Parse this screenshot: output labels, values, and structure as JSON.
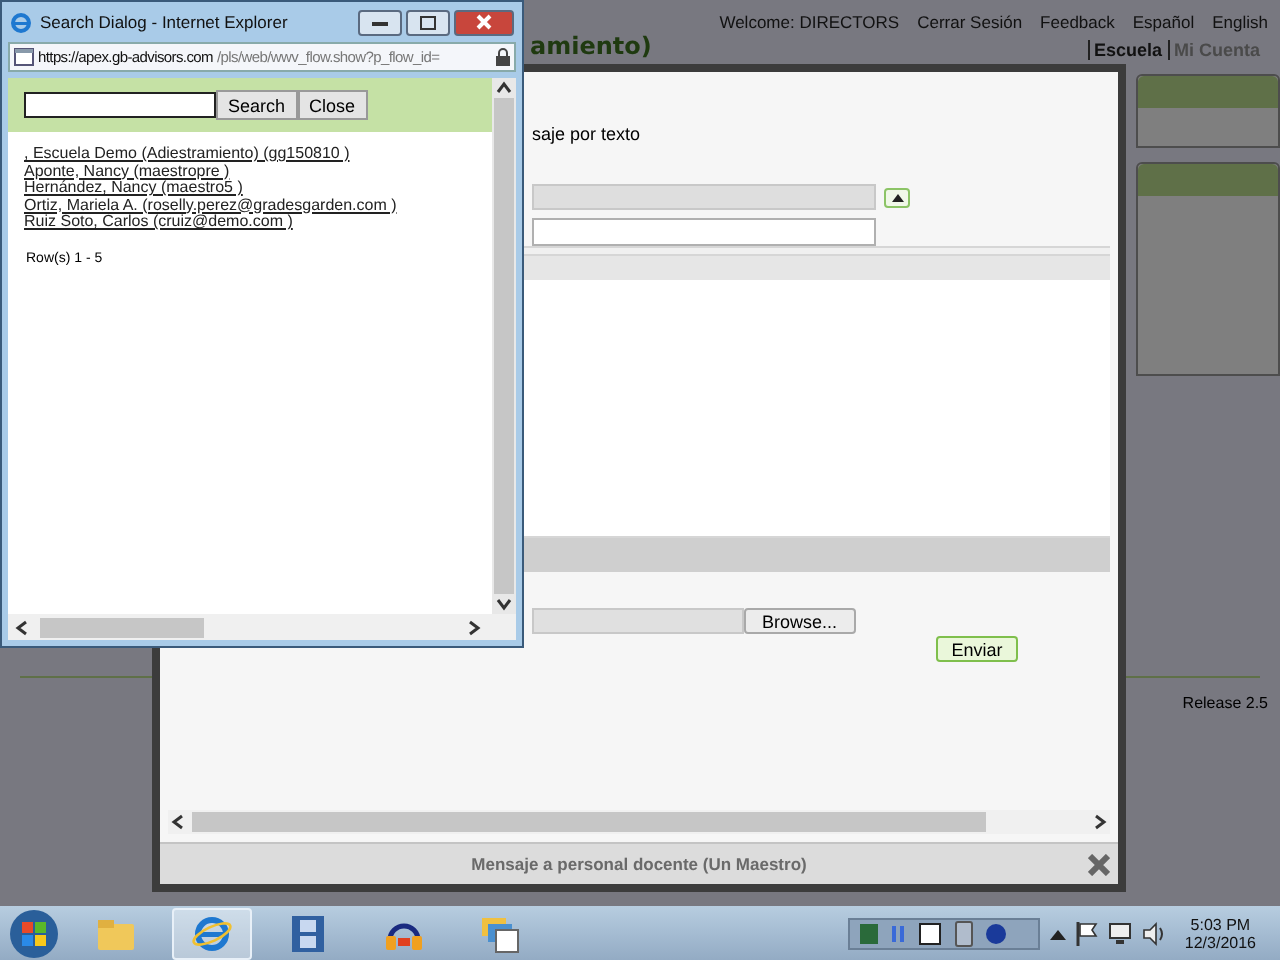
{
  "page": {
    "welcome": "Welcome: DIRECTORS",
    "header_links": [
      "Cerrar Sesión",
      "Feedback",
      "Español",
      "English"
    ],
    "title_fragment": "amiento)",
    "nav": [
      {
        "label": "Escuela",
        "selected": true
      },
      {
        "label": "Mi Cuenta",
        "selected": false
      }
    ],
    "release": "Release 2.5"
  },
  "modal": {
    "label_fragment": "saje por texto",
    "browse_button": "Browse...",
    "send_button": "Enviar",
    "footer_title": "Mensaje a personal docente (Un Maestro)"
  },
  "popup": {
    "title": "Search Dialog - Internet Explorer",
    "url_domain": "https://apex.gb-advisors.com",
    "url_path": "/pls/web/wwv_flow.show?p_flow_id=",
    "search_button": "Search",
    "close_button": "Close",
    "results": [
      ", Escuela Demo (Adiestramiento) (gg150810 )",
      "Aponte, Nancy (maestropre )",
      "Hernández, Nancy (maestro5 )",
      "Ortiz, Mariela A. (roselly.perez@gradesgarden.com )",
      "Ruiz Soto, Carlos (cruiz@demo.com )"
    ],
    "row_count": "Row(s) 1 - 5"
  },
  "taskbar": {
    "apps": [
      {
        "kind": "folder",
        "active": false
      },
      {
        "kind": "browser",
        "active": true
      },
      {
        "kind": "film",
        "active": false
      },
      {
        "kind": "audio",
        "active": false
      },
      {
        "kind": "documents",
        "active": false
      }
    ],
    "time": "5:03 PM",
    "date": "12/3/2016"
  }
}
